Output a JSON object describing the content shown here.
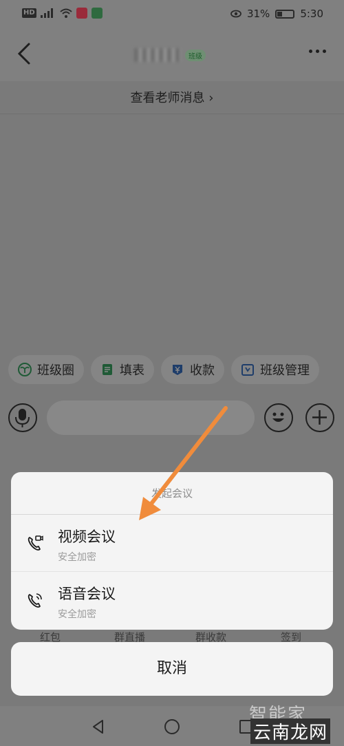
{
  "status": {
    "network_badge": "HD",
    "signal_label": "4G",
    "battery_pct": "31%",
    "battery_fraction": 0.31,
    "time": "5:30"
  },
  "navbar": {
    "class_badge": "班级"
  },
  "teacher_link": "查看老师消息 ›",
  "quick_actions": [
    {
      "label": "班级圈",
      "icon": "sprout-icon",
      "color": "#2e8b57"
    },
    {
      "label": "填表",
      "icon": "form-icon",
      "color": "#2e8b57"
    },
    {
      "label": "收款",
      "icon": "yen-icon",
      "color": "#1e4b8c"
    },
    {
      "label": "班级管理",
      "icon": "class-manage-icon",
      "color": "#1e4b8c"
    }
  ],
  "panel_labels": [
    "红包",
    "群直播",
    "群收款",
    "签到"
  ],
  "sheet": {
    "title": "发起会议",
    "items": [
      {
        "label": "视频会议",
        "sub": "安全加密",
        "icon": "video-call-icon"
      },
      {
        "label": "语音会议",
        "sub": "安全加密",
        "icon": "voice-call-icon"
      }
    ],
    "cancel": "取消"
  },
  "watermark": {
    "top": "智能家",
    "bottom": "云南龙网"
  },
  "colors": {
    "arrow": "#f08c3c",
    "overlay": "#7a7a7a",
    "sheet_bg": "#f4f4f4"
  }
}
